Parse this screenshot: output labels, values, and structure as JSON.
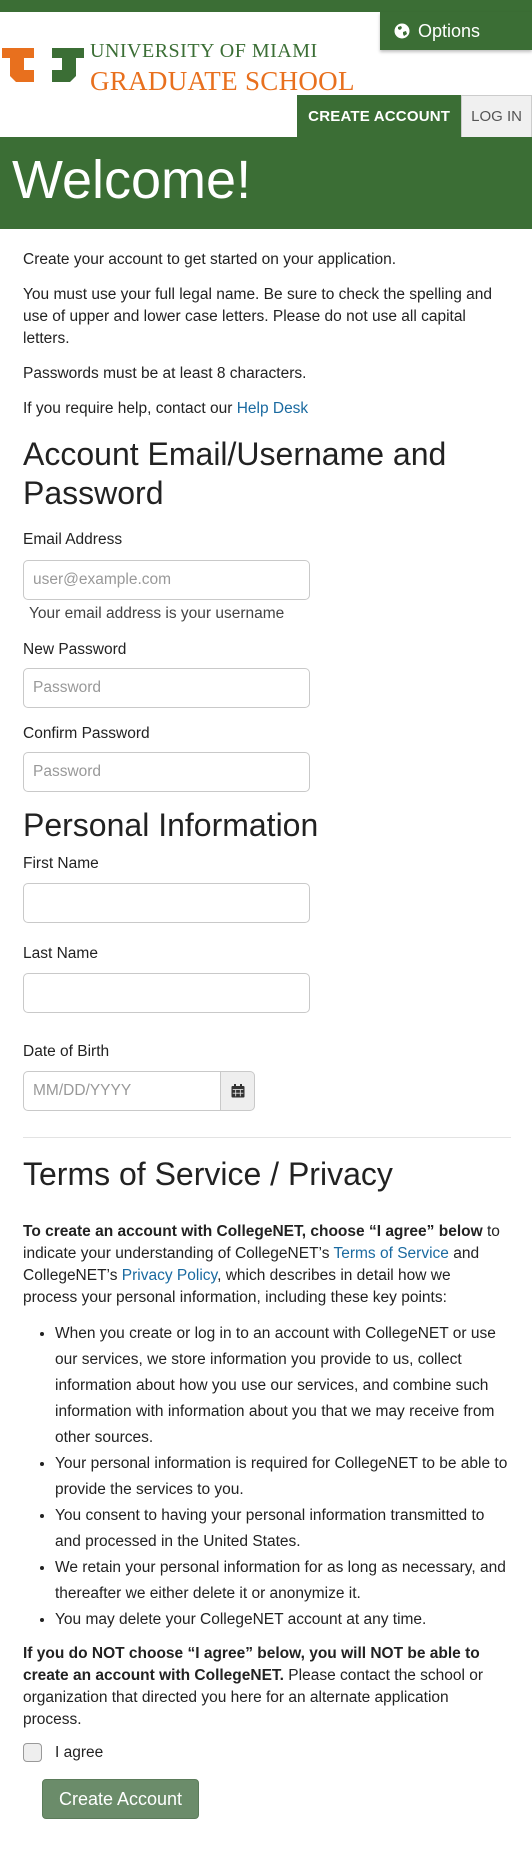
{
  "header": {
    "logo_line1": "UNIVERSITY OF MIAMI",
    "logo_line2": "GRADUATE SCHOOL",
    "options_label": "Options",
    "tabs": [
      {
        "label": "CREATE ACCOUNT"
      },
      {
        "label": "LOG IN"
      }
    ]
  },
  "banner": {
    "title": "Welcome!"
  },
  "intro": {
    "p1": "Create your account to get started on your application.",
    "p2": "You must use your full legal name. Be sure to check the spelling and use of upper and lower case letters. Please do not use all capital letters.",
    "p3": "Passwords must be at least 8 characters.",
    "p4_prefix": "If you require help, contact our ",
    "help_link": "Help Desk"
  },
  "account": {
    "heading": "Account Email/Username and Password",
    "email_label": "Email Address",
    "email_placeholder": "user@example.com",
    "email_help": "Your email address is your username",
    "new_password_label": "New Password",
    "new_password_placeholder": "Password",
    "confirm_password_label": "Confirm Password",
    "confirm_password_placeholder": "Password"
  },
  "personal": {
    "heading": "Personal Information",
    "first_name_label": "First Name",
    "last_name_label": "Last Name",
    "dob_label": "Date of Birth",
    "dob_placeholder": "MM/DD/YYYY"
  },
  "terms": {
    "heading": "Terms of Service / Privacy",
    "intro_bold": "To create an account with CollegeNET, choose “I agree” below",
    "intro_mid1": " to indicate your understanding of CollegeNET’s ",
    "tos_link": "Terms of Service",
    "intro_mid2": " and CollegeNET’s ",
    "privacy_link": "Privacy Policy",
    "intro_end": ", which describes in detail how we process your personal information, including these key points:",
    "points": [
      "When you create or log in to an account with CollegeNET or use our services, we store information you provide to us, collect information about how you use our services, and combine such information with information about you that we may receive from other sources.",
      "Your personal information is required for CollegeNET to be able to provide the services to you.",
      "You consent to having your personal information transmitted to and processed in the United States.",
      "We retain your personal information for as long as necessary, and thereafter we either delete it or anonymize it.",
      "You may delete your CollegeNET account at any time."
    ],
    "warning_bold": "If you do NOT choose “I agree” below, you will NOT be able to create an account with CollegeNET.",
    "warning_rest": " Please contact the school or organization that directed you here for an alternate application process.",
    "agree_label": "I agree",
    "submit_label": "Create Account"
  },
  "colors": {
    "brand_green": "#3b6e35",
    "brand_orange": "#e8701e",
    "link_blue": "#1a6aa0",
    "submit_disabled": "#6b8c6a"
  }
}
